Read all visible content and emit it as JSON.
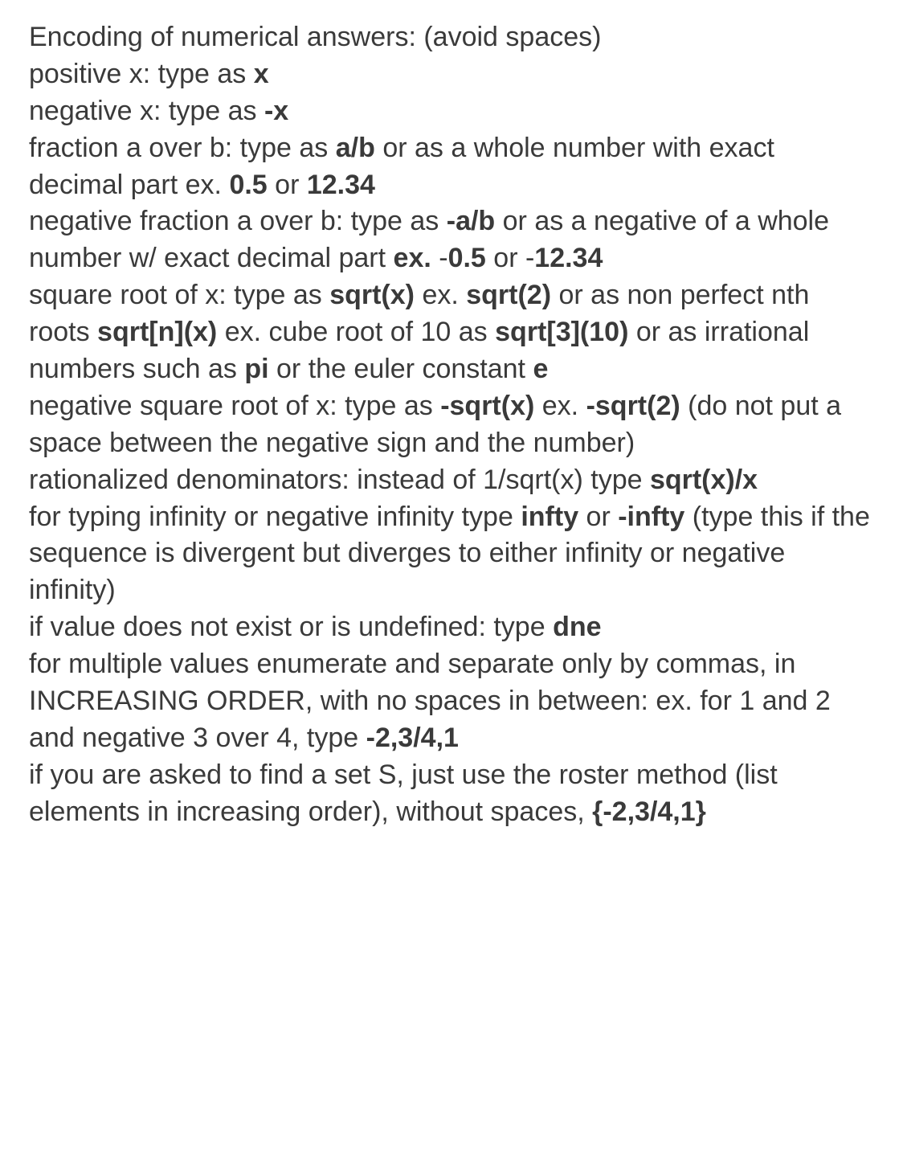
{
  "instructions": {
    "title_line": "Encoding of numerical answers: (avoid spaces)",
    "positive_x_prefix": "positive x: type as ",
    "positive_x_bold": "x",
    "negative_x_prefix": "negative x: type as ",
    "negative_x_bold": "-x",
    "fraction_prefix": "fraction a over b: type as ",
    "fraction_bold1": "a/b",
    "fraction_mid": " or as a whole number with exact decimal part ex. ",
    "fraction_bold2": "0.5",
    "fraction_or": " or ",
    "fraction_bold3": "12.34",
    "neg_fraction_prefix": "negative fraction a over b: type as ",
    "neg_fraction_bold1": "-a/b",
    "neg_fraction_mid1": " or as a negative of a whole number w/ exact decimal part ",
    "neg_fraction_bold_ex": "ex.",
    "neg_fraction_mid2": " -",
    "neg_fraction_bold2": "0.5",
    "neg_fraction_or": " or -",
    "neg_fraction_bold3": "12.34",
    "sqrt_prefix": "square root of x: type as ",
    "sqrt_bold1": "sqrt(x)",
    "sqrt_mid1": " ex. ",
    "sqrt_bold2": "sqrt(2)",
    "sqrt_mid2": " or as non perfect nth roots ",
    "sqrt_bold3": "sqrt[n](x)",
    "sqrt_mid3": " ex. cube root of 10 as ",
    "sqrt_bold4": "sqrt[3](10)",
    "sqrt_mid4": " or as irrational numbers such as ",
    "sqrt_bold5": "pi",
    "sqrt_mid5": "  or the euler constant ",
    "sqrt_bold6": "e",
    "neg_sqrt_prefix": "negative square root of x: type as ",
    "neg_sqrt_bold1": "-sqrt(x)",
    "neg_sqrt_mid1": " ex. ",
    "neg_sqrt_bold2": "-sqrt(2)",
    "neg_sqrt_mid2": " (do not put a space between the negative sign and the number)",
    "rational_prefix": "rationalized denominators: instead of 1/sqrt(x) type ",
    "rational_bold": "sqrt(x)/x",
    "infty_prefix": "for typing infinity or negative infinity type ",
    "infty_bold1": "infty",
    "infty_or": " or ",
    "infty_bold2": "-infty",
    "infty_suffix": " (type this if the sequence is divergent but diverges to either infinity or negative infinity)",
    "dne_prefix": "if value does not exist or is undefined: type ",
    "dne_bold": "dne",
    "multi_prefix": "for multiple values enumerate and separate only by commas, in INCREASING ORDER, with no spaces in between: ex. for 1 and 2 and negative 3 over 4, type ",
    "multi_bold": "-2,3/4,1",
    "set_prefix": "if you are asked to find a set S, just use the roster method (list elements in increasing order), without spaces, ",
    "set_bold": "{-2,3/4,1}"
  }
}
